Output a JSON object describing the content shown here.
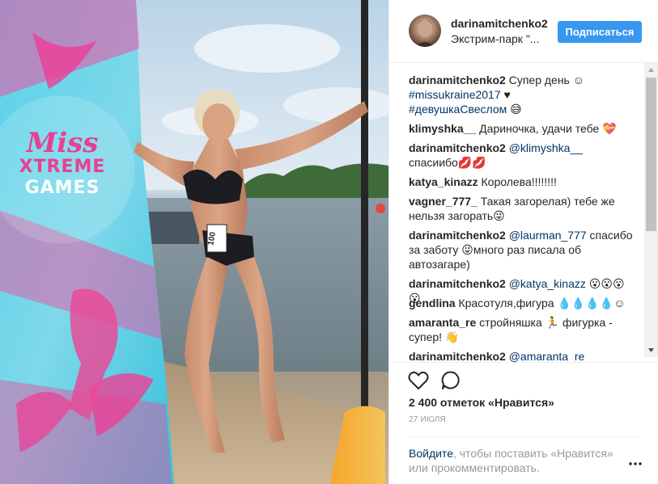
{
  "header": {
    "username": "darinamitchenko2",
    "location": "Экстрим-парк \"...",
    "follow_label": "Подписаться"
  },
  "photo": {
    "banner_text": [
      "Miss",
      "XTREME",
      "GAMES"
    ],
    "number_tag": "100"
  },
  "comments": [
    {
      "user": "darinamitchenko2",
      "parts": [
        {
          "t": "text",
          "v": " Супер день ☺"
        }
      ]
    },
    {
      "user": "",
      "parts": [
        {
          "t": "tag",
          "v": "#missukraine2017"
        },
        {
          "t": "text",
          "v": " ♥"
        }
      ]
    },
    {
      "user": "",
      "parts": [
        {
          "t": "tag",
          "v": "#девушкаСвеслом"
        },
        {
          "t": "text",
          "v": " 😅"
        }
      ]
    },
    {
      "user": "klimyshka__",
      "parts": [
        {
          "t": "text",
          "v": " Дариночка, удачи тебе 💝"
        }
      ]
    },
    {
      "user": "darinamitchenko2",
      "parts": [
        {
          "t": "text",
          "v": " "
        },
        {
          "t": "tag",
          "v": "@klimyshka__"
        }
      ]
    },
    {
      "user": "",
      "parts": [
        {
          "t": "text",
          "v": "спасиибо💋💋"
        }
      ]
    },
    {
      "user": "katya_kinazz",
      "parts": [
        {
          "t": "text",
          "v": " Королева!!!!!!!!"
        }
      ]
    },
    {
      "user": "vagner_777_",
      "parts": [
        {
          "t": "text",
          "v": " Такая загорелая) тебе же"
        }
      ]
    },
    {
      "user": "",
      "parts": [
        {
          "t": "text",
          "v": "нельзя загорать😜"
        }
      ]
    },
    {
      "user": "darinamitchenko2",
      "parts": [
        {
          "t": "text",
          "v": " "
        },
        {
          "t": "tag",
          "v": "@laurman_777"
        },
        {
          "t": "text",
          "v": " спасибо"
        }
      ]
    },
    {
      "user": "",
      "parts": [
        {
          "t": "text",
          "v": "за заботу 😜много раз писала об"
        }
      ]
    },
    {
      "user": "",
      "parts": [
        {
          "t": "text",
          "v": "автозагаре)"
        }
      ]
    },
    {
      "user": "darinamitchenko2",
      "parts": [
        {
          "t": "text",
          "v": " "
        },
        {
          "t": "tag",
          "v": "@katya_kinazz"
        },
        {
          "t": "text",
          "v": " 😮😮😮😮"
        }
      ]
    },
    {
      "user": "gendlina",
      "parts": [
        {
          "t": "text",
          "v": " Красотуля,фигура 💧💧💧💧☺"
        }
      ]
    },
    {
      "user": "amaranta_re",
      "parts": [
        {
          "t": "text",
          "v": " стройняшка 🏃 фигурка -"
        }
      ]
    },
    {
      "user": "",
      "parts": [
        {
          "t": "text",
          "v": "супер! 👋"
        }
      ]
    },
    {
      "user": "darinamitchenko2",
      "parts": [
        {
          "t": "text",
          "v": " "
        },
        {
          "t": "tag",
          "v": "@amaranta_re"
        }
      ]
    }
  ],
  "actions": {
    "like_icon": "heart-outline-icon",
    "comment_icon": "speech-bubble-icon",
    "likes_text": "2 400 отметок «Нравится»",
    "date": "27 ИЮЛЯ",
    "login_link": "Войдите",
    "login_rest": ", чтобы поставить «Нравится» или прокомментировать.",
    "more_icon": "three-dots-icon"
  },
  "colors": {
    "follow_bg": "#3897f0",
    "link": "#003569",
    "muted": "#999999"
  }
}
